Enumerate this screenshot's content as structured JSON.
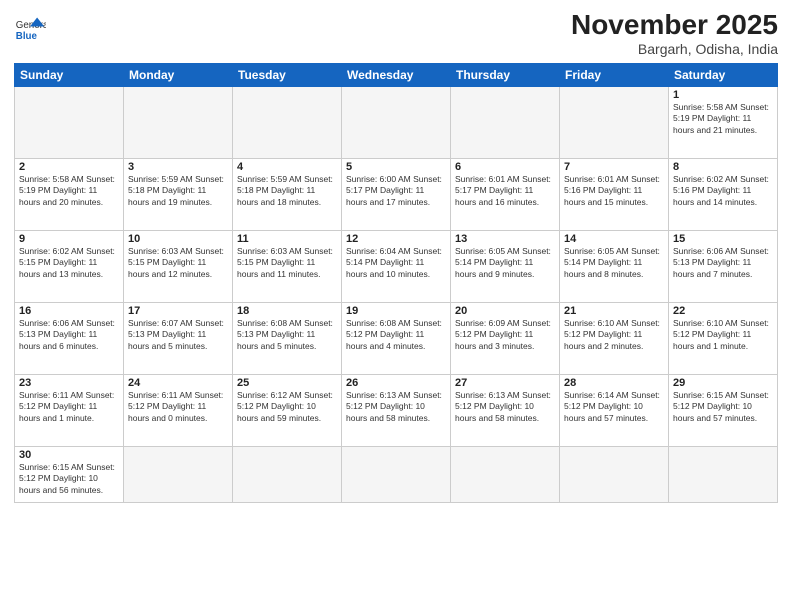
{
  "header": {
    "logo_general": "General",
    "logo_blue": "Blue",
    "month_title": "November 2025",
    "subtitle": "Bargarh, Odisha, India"
  },
  "weekdays": [
    "Sunday",
    "Monday",
    "Tuesday",
    "Wednesday",
    "Thursday",
    "Friday",
    "Saturday"
  ],
  "weeks": [
    [
      {
        "day": "",
        "info": ""
      },
      {
        "day": "",
        "info": ""
      },
      {
        "day": "",
        "info": ""
      },
      {
        "day": "",
        "info": ""
      },
      {
        "day": "",
        "info": ""
      },
      {
        "day": "",
        "info": ""
      },
      {
        "day": "1",
        "info": "Sunrise: 5:58 AM\nSunset: 5:19 PM\nDaylight: 11 hours\nand 21 minutes."
      }
    ],
    [
      {
        "day": "2",
        "info": "Sunrise: 5:58 AM\nSunset: 5:19 PM\nDaylight: 11 hours\nand 20 minutes."
      },
      {
        "day": "3",
        "info": "Sunrise: 5:59 AM\nSunset: 5:18 PM\nDaylight: 11 hours\nand 19 minutes."
      },
      {
        "day": "4",
        "info": "Sunrise: 5:59 AM\nSunset: 5:18 PM\nDaylight: 11 hours\nand 18 minutes."
      },
      {
        "day": "5",
        "info": "Sunrise: 6:00 AM\nSunset: 5:17 PM\nDaylight: 11 hours\nand 17 minutes."
      },
      {
        "day": "6",
        "info": "Sunrise: 6:01 AM\nSunset: 5:17 PM\nDaylight: 11 hours\nand 16 minutes."
      },
      {
        "day": "7",
        "info": "Sunrise: 6:01 AM\nSunset: 5:16 PM\nDaylight: 11 hours\nand 15 minutes."
      },
      {
        "day": "8",
        "info": "Sunrise: 6:02 AM\nSunset: 5:16 PM\nDaylight: 11 hours\nand 14 minutes."
      }
    ],
    [
      {
        "day": "9",
        "info": "Sunrise: 6:02 AM\nSunset: 5:15 PM\nDaylight: 11 hours\nand 13 minutes."
      },
      {
        "day": "10",
        "info": "Sunrise: 6:03 AM\nSunset: 5:15 PM\nDaylight: 11 hours\nand 12 minutes."
      },
      {
        "day": "11",
        "info": "Sunrise: 6:03 AM\nSunset: 5:15 PM\nDaylight: 11 hours\nand 11 minutes."
      },
      {
        "day": "12",
        "info": "Sunrise: 6:04 AM\nSunset: 5:14 PM\nDaylight: 11 hours\nand 10 minutes."
      },
      {
        "day": "13",
        "info": "Sunrise: 6:05 AM\nSunset: 5:14 PM\nDaylight: 11 hours\nand 9 minutes."
      },
      {
        "day": "14",
        "info": "Sunrise: 6:05 AM\nSunset: 5:14 PM\nDaylight: 11 hours\nand 8 minutes."
      },
      {
        "day": "15",
        "info": "Sunrise: 6:06 AM\nSunset: 5:13 PM\nDaylight: 11 hours\nand 7 minutes."
      }
    ],
    [
      {
        "day": "16",
        "info": "Sunrise: 6:06 AM\nSunset: 5:13 PM\nDaylight: 11 hours\nand 6 minutes."
      },
      {
        "day": "17",
        "info": "Sunrise: 6:07 AM\nSunset: 5:13 PM\nDaylight: 11 hours\nand 5 minutes."
      },
      {
        "day": "18",
        "info": "Sunrise: 6:08 AM\nSunset: 5:13 PM\nDaylight: 11 hours\nand 5 minutes."
      },
      {
        "day": "19",
        "info": "Sunrise: 6:08 AM\nSunset: 5:12 PM\nDaylight: 11 hours\nand 4 minutes."
      },
      {
        "day": "20",
        "info": "Sunrise: 6:09 AM\nSunset: 5:12 PM\nDaylight: 11 hours\nand 3 minutes."
      },
      {
        "day": "21",
        "info": "Sunrise: 6:10 AM\nSunset: 5:12 PM\nDaylight: 11 hours\nand 2 minutes."
      },
      {
        "day": "22",
        "info": "Sunrise: 6:10 AM\nSunset: 5:12 PM\nDaylight: 11 hours\nand 1 minute."
      }
    ],
    [
      {
        "day": "23",
        "info": "Sunrise: 6:11 AM\nSunset: 5:12 PM\nDaylight: 11 hours\nand 1 minute."
      },
      {
        "day": "24",
        "info": "Sunrise: 6:11 AM\nSunset: 5:12 PM\nDaylight: 11 hours\nand 0 minutes."
      },
      {
        "day": "25",
        "info": "Sunrise: 6:12 AM\nSunset: 5:12 PM\nDaylight: 10 hours\nand 59 minutes."
      },
      {
        "day": "26",
        "info": "Sunrise: 6:13 AM\nSunset: 5:12 PM\nDaylight: 10 hours\nand 58 minutes."
      },
      {
        "day": "27",
        "info": "Sunrise: 6:13 AM\nSunset: 5:12 PM\nDaylight: 10 hours\nand 58 minutes."
      },
      {
        "day": "28",
        "info": "Sunrise: 6:14 AM\nSunset: 5:12 PM\nDaylight: 10 hours\nand 57 minutes."
      },
      {
        "day": "29",
        "info": "Sunrise: 6:15 AM\nSunset: 5:12 PM\nDaylight: 10 hours\nand 57 minutes."
      }
    ],
    [
      {
        "day": "30",
        "info": "Sunrise: 6:15 AM\nSunset: 5:12 PM\nDaylight: 10 hours\nand 56 minutes."
      },
      {
        "day": "",
        "info": ""
      },
      {
        "day": "",
        "info": ""
      },
      {
        "day": "",
        "info": ""
      },
      {
        "day": "",
        "info": ""
      },
      {
        "day": "",
        "info": ""
      },
      {
        "day": "",
        "info": ""
      }
    ]
  ]
}
